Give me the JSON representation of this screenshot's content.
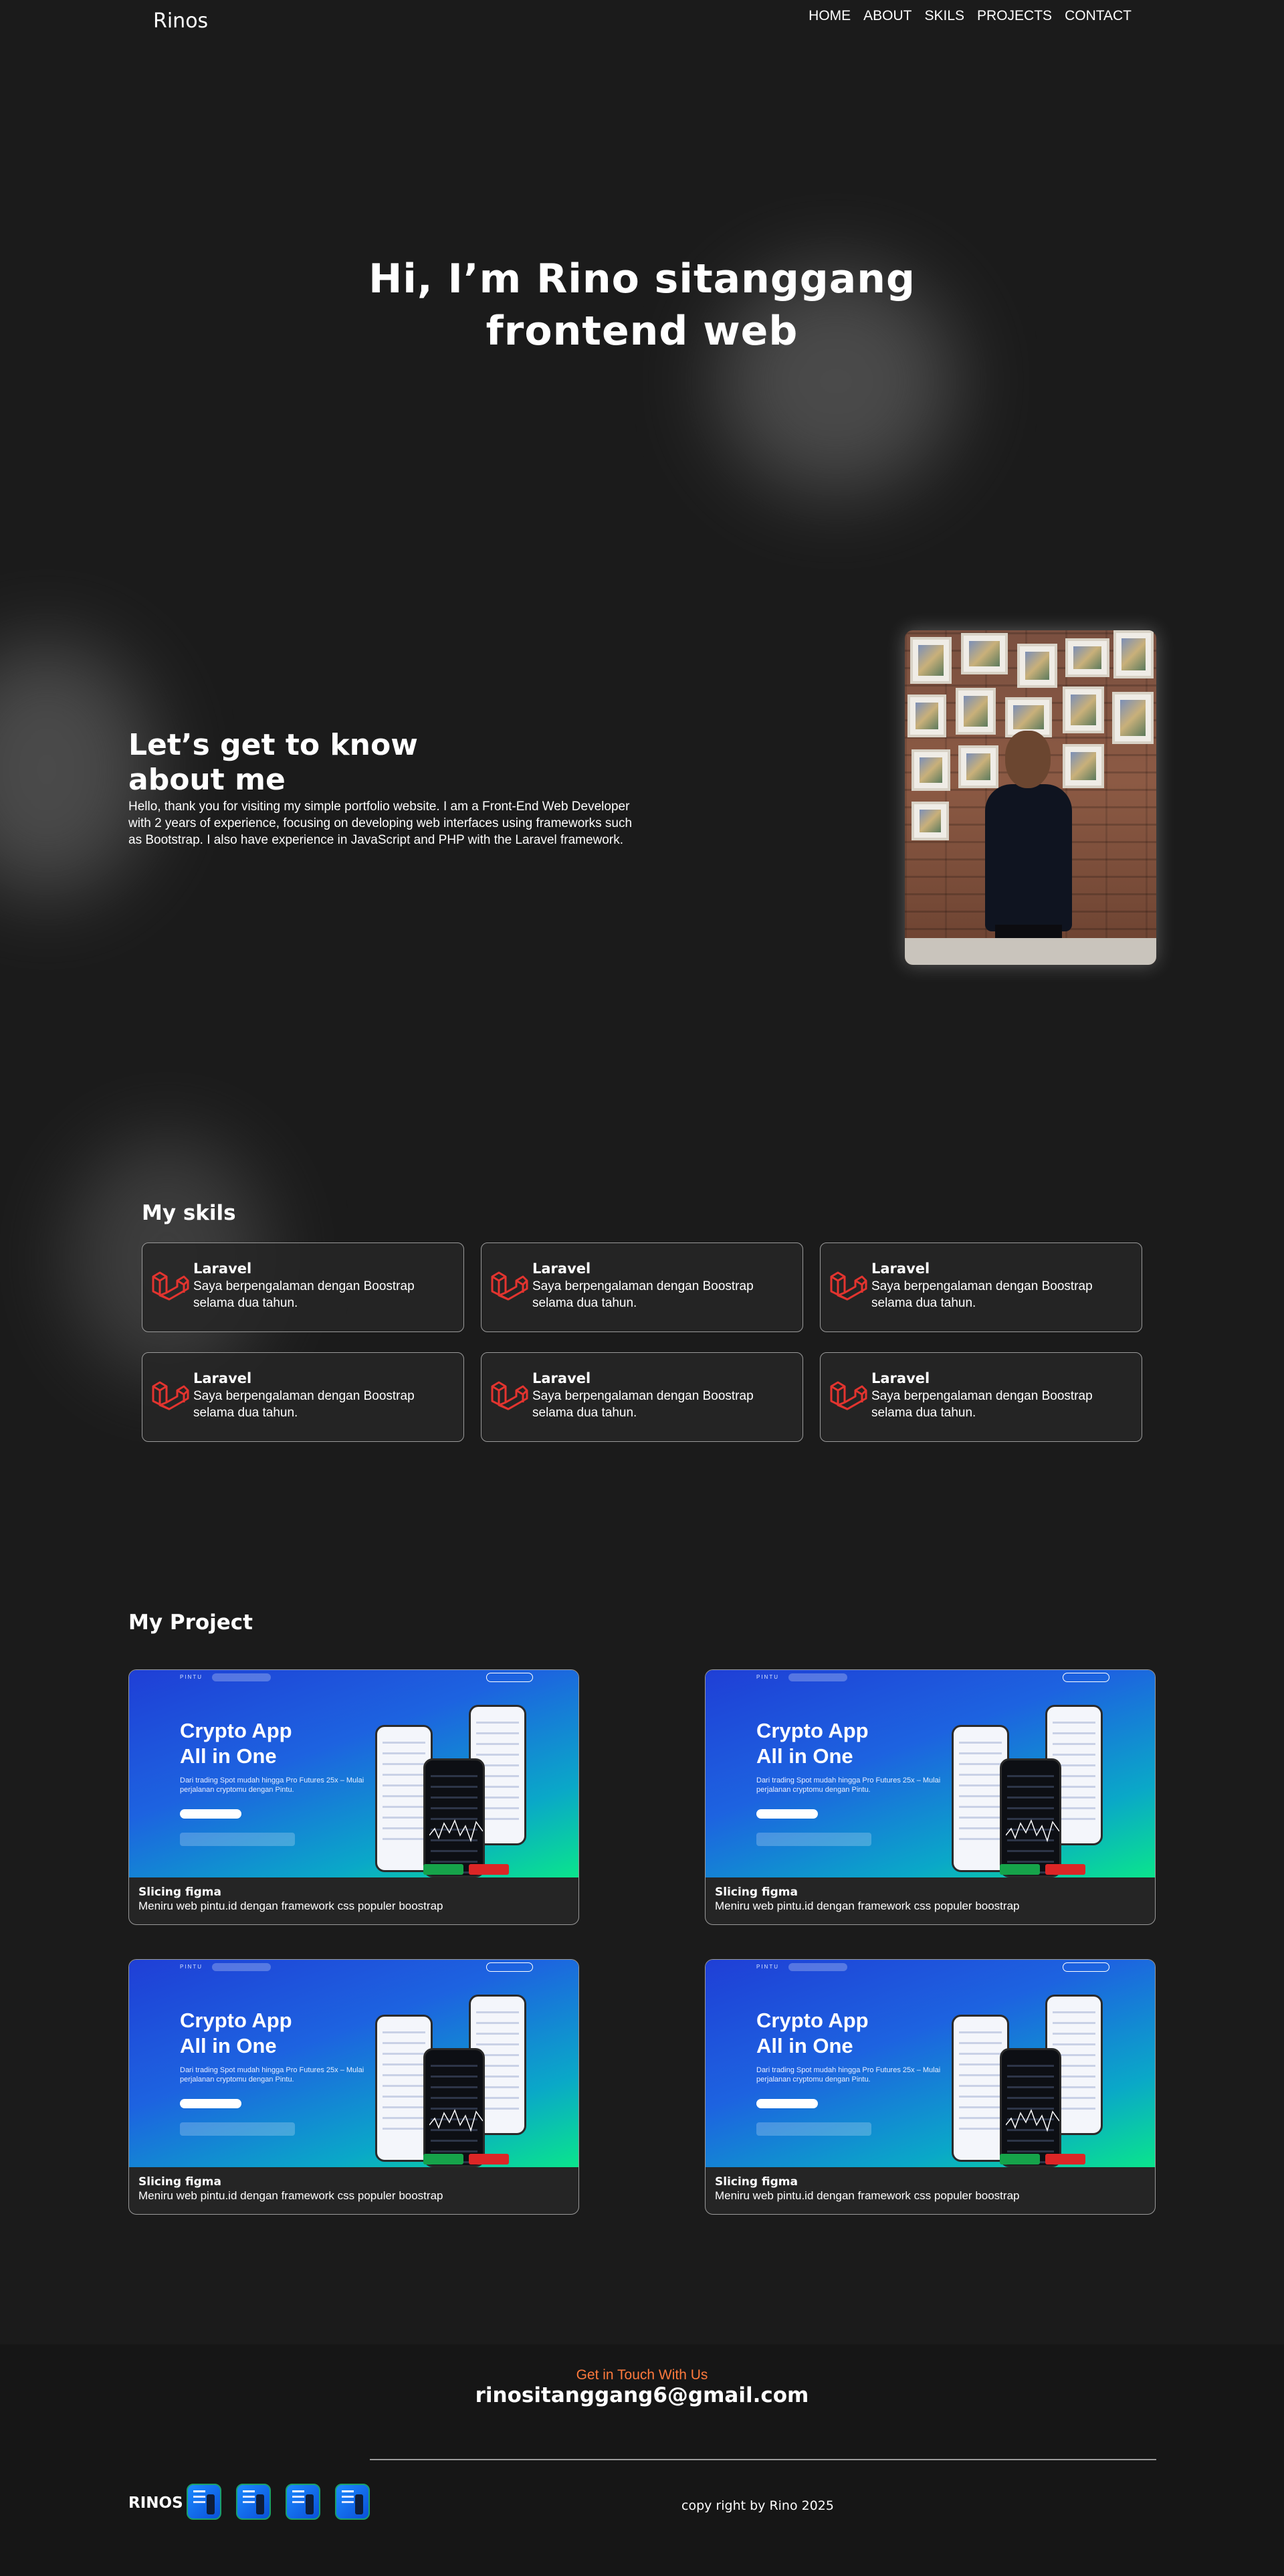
{
  "nav": {
    "brand": "Rinos",
    "items": [
      "HOME",
      "ABOUT",
      "SKILS",
      "PROJECTS",
      "CONTACT"
    ]
  },
  "hero": {
    "line1": "Hi, I’m Rino sitanggang",
    "line2": "frontend web"
  },
  "about": {
    "title": "Let’s get to know about me",
    "text": "Hello, thank you for visiting my simple portfolio website. I am a Front-End Web Developer with 2 years of experience, focusing on developing web interfaces using frameworks such as Bootstrap. I also have experience in JavaScript and PHP with the Laravel framework."
  },
  "skills": {
    "title": "My skils",
    "icon": "laravel-icon",
    "icon_color": "#e3342f",
    "items": [
      {
        "name": "Laravel",
        "desc": "Saya berpengalaman dengan Boostrap selama dua tahun."
      },
      {
        "name": "Laravel",
        "desc": "Saya berpengalaman dengan Boostrap selama dua tahun."
      },
      {
        "name": "Laravel",
        "desc": "Saya berpengalaman dengan Boostrap selama dua tahun."
      },
      {
        "name": "Laravel",
        "desc": "Saya berpengalaman dengan Boostrap selama dua tahun."
      },
      {
        "name": "Laravel",
        "desc": "Saya berpengalaman dengan Boostrap selama dua tahun."
      },
      {
        "name": "Laravel",
        "desc": "Saya berpengalaman dengan Boostrap selama dua tahun."
      }
    ]
  },
  "projects": {
    "title": "My Project",
    "preview": {
      "headline1": "Crypto App",
      "headline2": "All in One",
      "sub": "Dari trading Spot mudah hingga Pro Futures 25x – Mulai perjalanan cryptomu dengan Pintu.",
      "logo": "PINTU"
    },
    "items": [
      {
        "name": "Slicing figma",
        "desc": "Meniru web pintu.id dengan framework css populer boostrap"
      },
      {
        "name": "Slicing figma",
        "desc": "Meniru web pintu.id dengan framework css populer boostrap"
      },
      {
        "name": "Slicing figma",
        "desc": "Meniru web pintu.id dengan framework css populer boostrap"
      },
      {
        "name": "Slicing figma",
        "desc": "Meniru web pintu.id dengan framework css populer boostrap"
      }
    ]
  },
  "footer": {
    "touch": "Get in Touch With Us",
    "email": "rinositanggang6@gmail.com",
    "brand": "RINOS",
    "copyright": "copy right by Rino 2025",
    "accent": "#ff7a3d"
  }
}
